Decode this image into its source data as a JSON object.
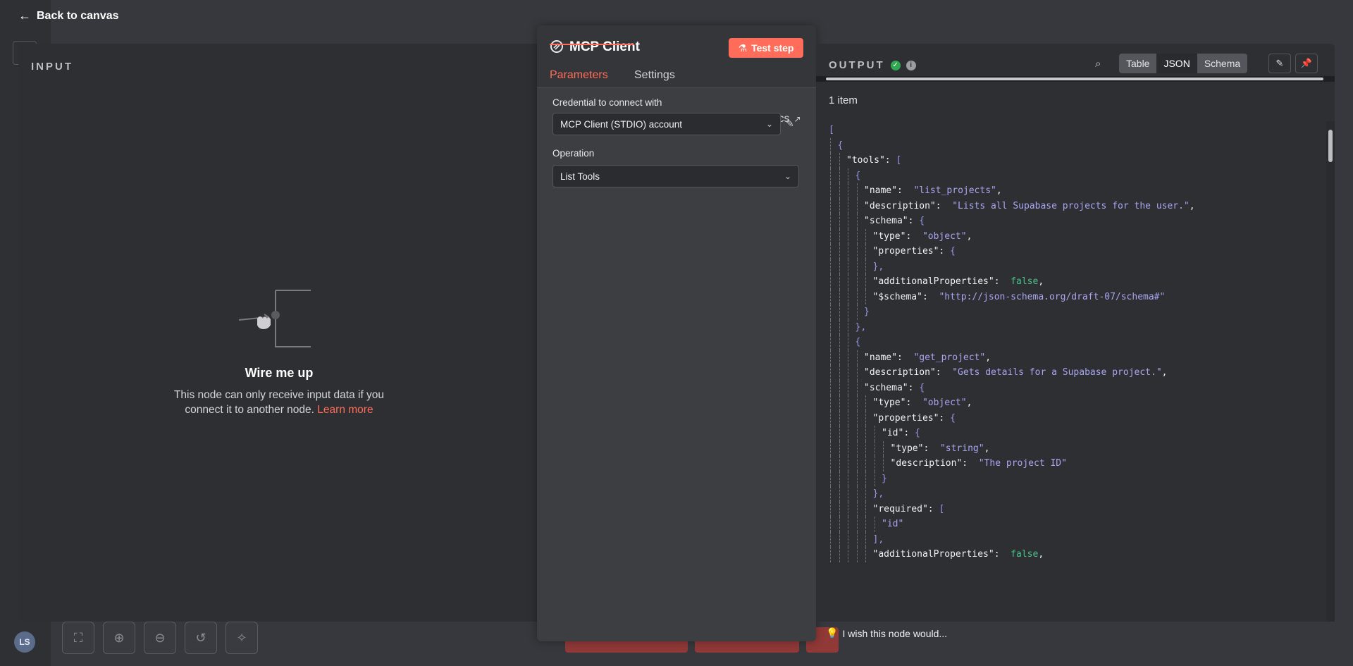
{
  "nav": {
    "back_label": "Back to canvas"
  },
  "avatar": {
    "initials": "LS"
  },
  "input": {
    "title": "INPUT",
    "empty_title": "Wire me up",
    "empty_desc": "This node can only receive input data if you connect it to another node.",
    "learn_more": "Learn more"
  },
  "node": {
    "title": "MCP Client",
    "test_button": "Test step",
    "tabs": [
      "Parameters",
      "Settings"
    ],
    "docs": "Docs",
    "credential_label": "Credential to connect with",
    "credential_value": "MCP Client (STDIO) account",
    "operation_label": "Operation",
    "operation_value": "List Tools",
    "wish": "I wish this node would..."
  },
  "output": {
    "title": "OUTPUT",
    "views": [
      "Table",
      "JSON",
      "Schema"
    ],
    "active_view": "JSON",
    "items_count": "1 item"
  },
  "json_lines": [
    {
      "indent": 0,
      "parts": [
        [
          "p",
          "["
        ]
      ]
    },
    {
      "indent": 1,
      "parts": [
        [
          "p",
          "{"
        ]
      ]
    },
    {
      "indent": 2,
      "parts": [
        [
          "k",
          "\"tools\""
        ],
        [
          "k",
          ": "
        ],
        [
          "p",
          "["
        ]
      ]
    },
    {
      "indent": 3,
      "parts": [
        [
          "p",
          "{"
        ]
      ]
    },
    {
      "indent": 4,
      "parts": [
        [
          "k",
          "\"name\""
        ],
        [
          "k",
          ":  "
        ],
        [
          "s",
          "\"list_projects\""
        ],
        [
          "k",
          ","
        ]
      ]
    },
    {
      "indent": 4,
      "parts": [
        [
          "k",
          "\"description\""
        ],
        [
          "k",
          ":  "
        ],
        [
          "s",
          "\"Lists all Supabase projects for the user.\""
        ],
        [
          "k",
          ","
        ]
      ]
    },
    {
      "indent": 4,
      "parts": [
        [
          "k",
          "\"schema\""
        ],
        [
          "k",
          ": "
        ],
        [
          "p",
          "{"
        ]
      ]
    },
    {
      "indent": 5,
      "parts": [
        [
          "k",
          "\"type\""
        ],
        [
          "k",
          ":  "
        ],
        [
          "s",
          "\"object\""
        ],
        [
          "k",
          ","
        ]
      ]
    },
    {
      "indent": 5,
      "parts": [
        [
          "k",
          "\"properties\""
        ],
        [
          "k",
          ": "
        ],
        [
          "p",
          "{"
        ]
      ]
    },
    {
      "indent": 5,
      "parts": [
        [
          "p",
          "},"
        ]
      ]
    },
    {
      "indent": 5,
      "parts": [
        [
          "k",
          "\"additionalProperties\""
        ],
        [
          "k",
          ":  "
        ],
        [
          "b",
          "false"
        ],
        [
          "k",
          ","
        ]
      ]
    },
    {
      "indent": 5,
      "parts": [
        [
          "k",
          "\"$schema\""
        ],
        [
          "k",
          ":  "
        ],
        [
          "s",
          "\"http://json-schema.org/draft-07/schema#\""
        ]
      ]
    },
    {
      "indent": 4,
      "parts": [
        [
          "p",
          "}"
        ]
      ]
    },
    {
      "indent": 3,
      "parts": [
        [
          "p",
          "},"
        ]
      ]
    },
    {
      "indent": 3,
      "parts": [
        [
          "p",
          "{"
        ]
      ]
    },
    {
      "indent": 4,
      "parts": [
        [
          "k",
          "\"name\""
        ],
        [
          "k",
          ":  "
        ],
        [
          "s",
          "\"get_project\""
        ],
        [
          "k",
          ","
        ]
      ]
    },
    {
      "indent": 4,
      "parts": [
        [
          "k",
          "\"description\""
        ],
        [
          "k",
          ":  "
        ],
        [
          "s",
          "\"Gets details for a Supabase project.\""
        ],
        [
          "k",
          ","
        ]
      ]
    },
    {
      "indent": 4,
      "parts": [
        [
          "k",
          "\"schema\""
        ],
        [
          "k",
          ": "
        ],
        [
          "p",
          "{"
        ]
      ]
    },
    {
      "indent": 5,
      "parts": [
        [
          "k",
          "\"type\""
        ],
        [
          "k",
          ":  "
        ],
        [
          "s",
          "\"object\""
        ],
        [
          "k",
          ","
        ]
      ]
    },
    {
      "indent": 5,
      "parts": [
        [
          "k",
          "\"properties\""
        ],
        [
          "k",
          ": "
        ],
        [
          "p",
          "{"
        ]
      ]
    },
    {
      "indent": 6,
      "parts": [
        [
          "k",
          "\"id\""
        ],
        [
          "k",
          ": "
        ],
        [
          "p",
          "{"
        ]
      ]
    },
    {
      "indent": 7,
      "parts": [
        [
          "k",
          "\"type\""
        ],
        [
          "k",
          ":  "
        ],
        [
          "s",
          "\"string\""
        ],
        [
          "k",
          ","
        ]
      ]
    },
    {
      "indent": 7,
      "parts": [
        [
          "k",
          "\"description\""
        ],
        [
          "k",
          ":  "
        ],
        [
          "s",
          "\"The project ID\""
        ]
      ]
    },
    {
      "indent": 6,
      "parts": [
        [
          "p",
          "}"
        ]
      ]
    },
    {
      "indent": 5,
      "parts": [
        [
          "p",
          "},"
        ]
      ]
    },
    {
      "indent": 5,
      "parts": [
        [
          "k",
          "\"required\""
        ],
        [
          "k",
          ": "
        ],
        [
          "p",
          "["
        ]
      ]
    },
    {
      "indent": 6,
      "parts": [
        [
          "s",
          "\"id\""
        ]
      ]
    },
    {
      "indent": 5,
      "parts": [
        [
          "p",
          "],"
        ]
      ]
    },
    {
      "indent": 5,
      "parts": [
        [
          "k",
          "\"additionalProperties\""
        ],
        [
          "k",
          ":  "
        ],
        [
          "b",
          "false"
        ],
        [
          "k",
          ","
        ]
      ]
    }
  ],
  "colors": {
    "accent": "#ff6d5a",
    "success": "#2fa84f",
    "json_string": "#a9a6f0",
    "json_bool": "#48c28a"
  }
}
